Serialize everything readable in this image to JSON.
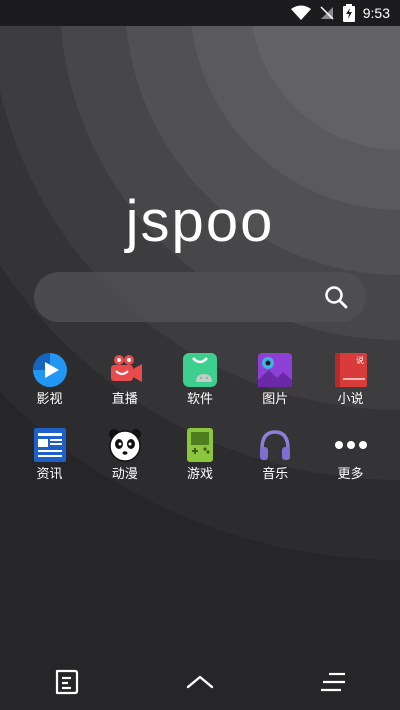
{
  "status_bar": {
    "time": "9:53"
  },
  "brand": {
    "logo_text": "jspoo"
  },
  "search": {
    "placeholder": ""
  },
  "apps": {
    "row1": [
      {
        "label": "影视",
        "icon": "video-icon",
        "color": "#2196f3"
      },
      {
        "label": "直播",
        "icon": "camera-icon",
        "color": "#e84b4b"
      },
      {
        "label": "软件",
        "icon": "android-bag-icon",
        "color": "#3ccf8e"
      },
      {
        "label": "图片",
        "icon": "picture-icon",
        "color": "#8e3fd6"
      },
      {
        "label": "小说",
        "icon": "book-icon",
        "color": "#d93b3b"
      }
    ],
    "row2": [
      {
        "label": "资讯",
        "icon": "news-icon",
        "color": "#1e60c8"
      },
      {
        "label": "动漫",
        "icon": "panda-icon",
        "color": "#ffffff"
      },
      {
        "label": "游戏",
        "icon": "gameboy-icon",
        "color": "#8cc63f"
      },
      {
        "label": "音乐",
        "icon": "headphones-icon",
        "color": "#8a7fd9"
      },
      {
        "label": "更多",
        "icon": "more-icon",
        "color": "#ffffff"
      }
    ]
  },
  "book_icon_text": "说"
}
